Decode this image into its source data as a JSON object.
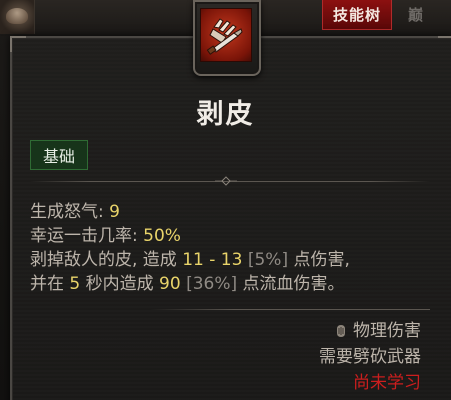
{
  "top_bar": {
    "skill_tree_tab": "技能树",
    "next_tab_fragment": "巅"
  },
  "skill": {
    "name": "剥皮",
    "icon": "flay-blade-icon",
    "tag": "基础",
    "stats": [
      {
        "label": "生成怒气",
        "separator": ": ",
        "value": "9"
      },
      {
        "label": "幸运一击几率",
        "separator": ": ",
        "value": "50%"
      }
    ],
    "description": {
      "line1": {
        "text_a": "剥掉敌人的皮, 造成 ",
        "damage": "11 - 13",
        "pct": " [5%]",
        "text_b": " 点伤害,"
      },
      "line2": {
        "text_a": "并在 ",
        "duration": "5",
        "text_b": " 秒内造成 ",
        "bleed": "90",
        "pct": " [36%]",
        "text_c": " 点流血伤害。"
      }
    },
    "damage_type": "物理伤害",
    "damage_type_icon": "physical-damage-icon",
    "requirement": "需要劈砍武器",
    "status": "尚未学习"
  },
  "colors": {
    "number": "#e9d46a",
    "locked": "#cc1e1e",
    "tag_bg": "#17341a",
    "tab_red": "#8c1010"
  }
}
